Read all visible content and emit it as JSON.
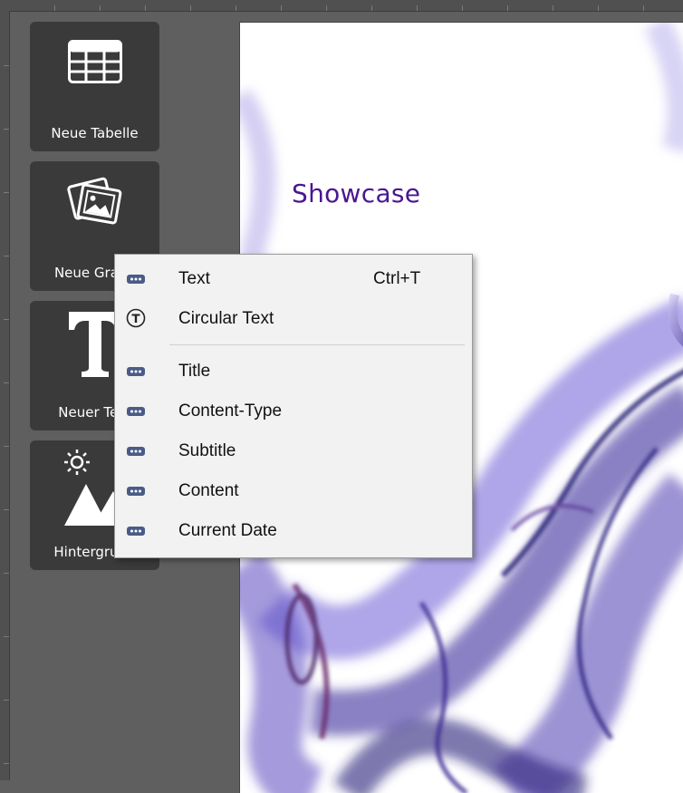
{
  "toolbar": {
    "new_table": {
      "label": "Neue Tabelle",
      "icon": "table-icon"
    },
    "new_graphic": {
      "label": "Neue Grafik",
      "icon": "picture-icon"
    },
    "new_text": {
      "label": "Neuer Text",
      "icon": "text-t-icon"
    },
    "background": {
      "label": "Hintergrund",
      "icon": "mountain-sun-icon"
    }
  },
  "canvas": {
    "title": "Showcase",
    "title_color": "#4a1790"
  },
  "context_menu": {
    "items": [
      {
        "label": "Text",
        "shortcut": "Ctrl+T",
        "icon": "text-field-icon"
      },
      {
        "label": "Circular Text",
        "shortcut": "",
        "icon": "circular-text-icon"
      },
      {
        "label": "Title",
        "shortcut": "",
        "icon": "text-field-icon"
      },
      {
        "label": "Content-Type",
        "shortcut": "",
        "icon": "text-field-icon"
      },
      {
        "label": "Subtitle",
        "shortcut": "",
        "icon": "text-field-icon"
      },
      {
        "label": "Content",
        "shortcut": "",
        "icon": "text-field-icon"
      },
      {
        "label": "Current Date",
        "shortcut": "",
        "icon": "text-field-icon"
      }
    ]
  }
}
